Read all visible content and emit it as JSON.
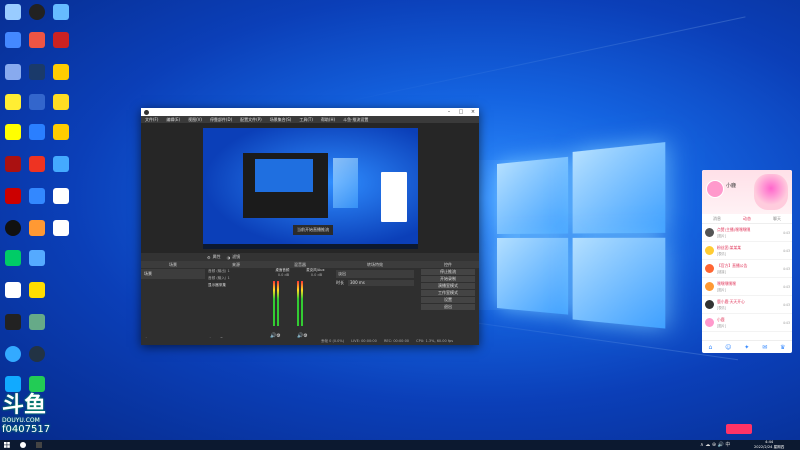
{
  "desktop": {
    "watermark_brand": "斗鱼",
    "watermark_sub": "DOUYU.COM",
    "room_id": "f0407517"
  },
  "obs": {
    "menu": [
      "文件(F)",
      "编辑(E)",
      "视图(V)",
      "停靠部件(D)",
      "配置文件(P)",
      "场景集合(S)",
      "工具(T)",
      "帮助(H)",
      "斗鱼·推流设置"
    ],
    "preview_overlay": "当前开始直播推流",
    "toolbar": [
      "属性",
      "滤镜"
    ],
    "docks": {
      "scenes": {
        "title": "场景",
        "items": [
          "场景"
        ]
      },
      "sources": {
        "title": "来源",
        "items": [
          "音频 (输出) 1",
          "音频 (输入) 1",
          "显示器采集"
        ]
      },
      "mixer": {
        "title": "混音器",
        "channels": [
          "桌面音频",
          "麦克风/Aux"
        ],
        "level": "0.0 dB"
      },
      "transitions": {
        "title": "转场特效",
        "type": "淡出",
        "duration_label": "时长",
        "duration": "300 ms"
      },
      "controls": {
        "title": "控件",
        "buttons": [
          "停止推流",
          "开始录制",
          "演播室模式",
          "设置",
          "退出"
        ],
        "extra": "工作室模式"
      }
    },
    "status": {
      "live": "LIVE: 00:00:00",
      "rec": "REC: 00:00:00",
      "cpu": "CPU: 1.3%, 60.00 fps",
      "dropped": "丢帧 0 (0.0%)"
    }
  },
  "chat": {
    "username": "小鹿",
    "tabs": [
      "消息",
      "动态",
      "聊天"
    ],
    "items": [
      {
        "name": "点赞(主播)嘿嘿嘿嘿",
        "msg": "[图片]",
        "time": "4:43"
      },
      {
        "name": "粉丝团:某某某",
        "msg": "[表情]",
        "time": "4:43"
      },
      {
        "name": "【官方】直播公告",
        "msg": "[链接]",
        "time": "4:43"
      },
      {
        "name": "嘿嘿嘿嘿嘿",
        "msg": "[图片]",
        "time": "4:43"
      },
      {
        "name": "鹿小鹿·天天开心",
        "msg": "[表情]",
        "time": "4:43"
      },
      {
        "name": "小鹿",
        "msg": "[图片]",
        "time": "4:43"
      }
    ]
  },
  "taskbar": {
    "time": "4:44",
    "date": "2022/2/24 星期四"
  }
}
